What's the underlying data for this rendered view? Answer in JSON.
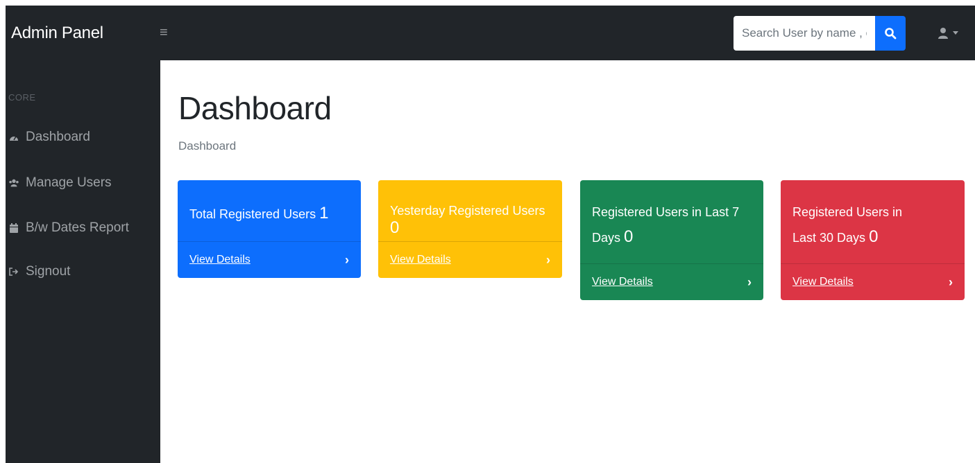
{
  "app": {
    "title": "Admin Panel"
  },
  "search": {
    "placeholder": "Search User by name , email"
  },
  "sidebar": {
    "heading": "CORE",
    "items": [
      {
        "label": "Dashboard",
        "icon": "tachometer-icon"
      },
      {
        "label": "Manage Users",
        "icon": "users-icon"
      },
      {
        "label": "B/w Dates Report",
        "icon": "calendar-icon"
      },
      {
        "label": "Signout",
        "icon": "signout-icon"
      }
    ]
  },
  "page": {
    "title": "Dashboard",
    "breadcrumb": "Dashboard"
  },
  "cards": [
    {
      "label": "Total Registered Users",
      "value": "1",
      "link": "View Details",
      "color": "#0d6efd"
    },
    {
      "label": "Yesterday Registered Users",
      "value": "0",
      "link": "View Details",
      "color": "#ffc107"
    },
    {
      "label": "Registered Users in Last 7 Days",
      "value": "0",
      "link": "View Details",
      "color": "#198754"
    },
    {
      "label": "Registered Users in Last 30 Days",
      "value": "0",
      "link": "View Details",
      "color": "#dc3545"
    }
  ]
}
